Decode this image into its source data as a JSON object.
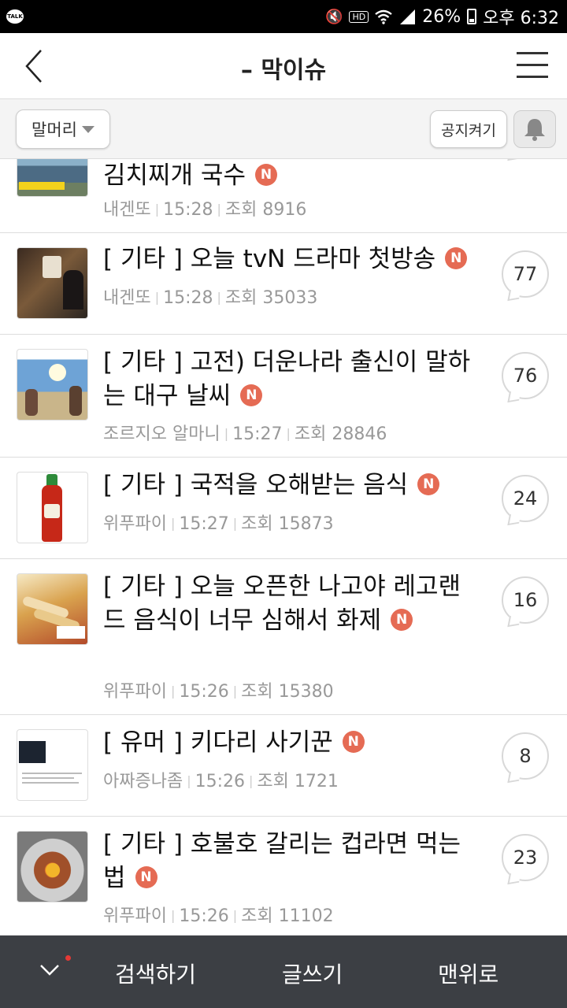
{
  "status_bar": {
    "app_badge": "TALK",
    "hd_label": "HD",
    "battery": "26%",
    "time": "오후 6:32"
  },
  "header": {
    "title": "– 막이슈"
  },
  "toolbar": {
    "dropdown_label": "말머리",
    "notice_label": "공지켜기"
  },
  "posts": [
    {
      "title": "김치찌개 국수",
      "author": "내겐또",
      "time": "15:28",
      "views": "조회 8916",
      "comments": "",
      "new_badge": "N"
    },
    {
      "title": "[ 기타 ] 오늘 tvN 드라마 첫방송",
      "author": "내겐또",
      "time": "15:28",
      "views": "조회 35033",
      "comments": "77",
      "new_badge": "N"
    },
    {
      "title": "[ 기타 ] 고전) 더운나라 출신이 말하는 대구 날씨",
      "author": "조르지오 알마니",
      "time": "15:27",
      "views": "조회 28846",
      "comments": "76",
      "new_badge": "N"
    },
    {
      "title": "[ 기타 ] 국적을 오해받는 음식",
      "author": "위푸파이",
      "time": "15:27",
      "views": "조회 15873",
      "comments": "24",
      "new_badge": "N"
    },
    {
      "title": "[ 기타 ] 오늘 오픈한 나고야 레고랜드 음식이 너무 심해서 화제",
      "author": "위푸파이",
      "time": "15:26",
      "views": "조회 15380",
      "comments": "16",
      "new_badge": "N"
    },
    {
      "title": "[ 유머 ] 키다리 사기꾼",
      "author": "아짜증나좀",
      "time": "15:26",
      "views": "조회 1721",
      "comments": "8",
      "new_badge": "N"
    },
    {
      "title": "[ 기타 ] 호불호 갈리는 컵라면 먹는 법",
      "author": "위푸파이",
      "time": "15:26",
      "views": "조회 11102",
      "comments": "23",
      "new_badge": "N"
    }
  ],
  "bottom_bar": {
    "search": "검색하기",
    "write": "글쓰기",
    "top": "맨위로"
  },
  "colors": {
    "new_badge": "#e56b54",
    "bottom_bar": "#3c3f44",
    "notification_dot": "#e53935"
  },
  "icons": [
    "back-arrow-icon",
    "hamburger-menu-icon",
    "bell-icon",
    "chevron-down-icon",
    "wifi-icon",
    "signal-icon",
    "mute-icon",
    "battery-icon"
  ]
}
